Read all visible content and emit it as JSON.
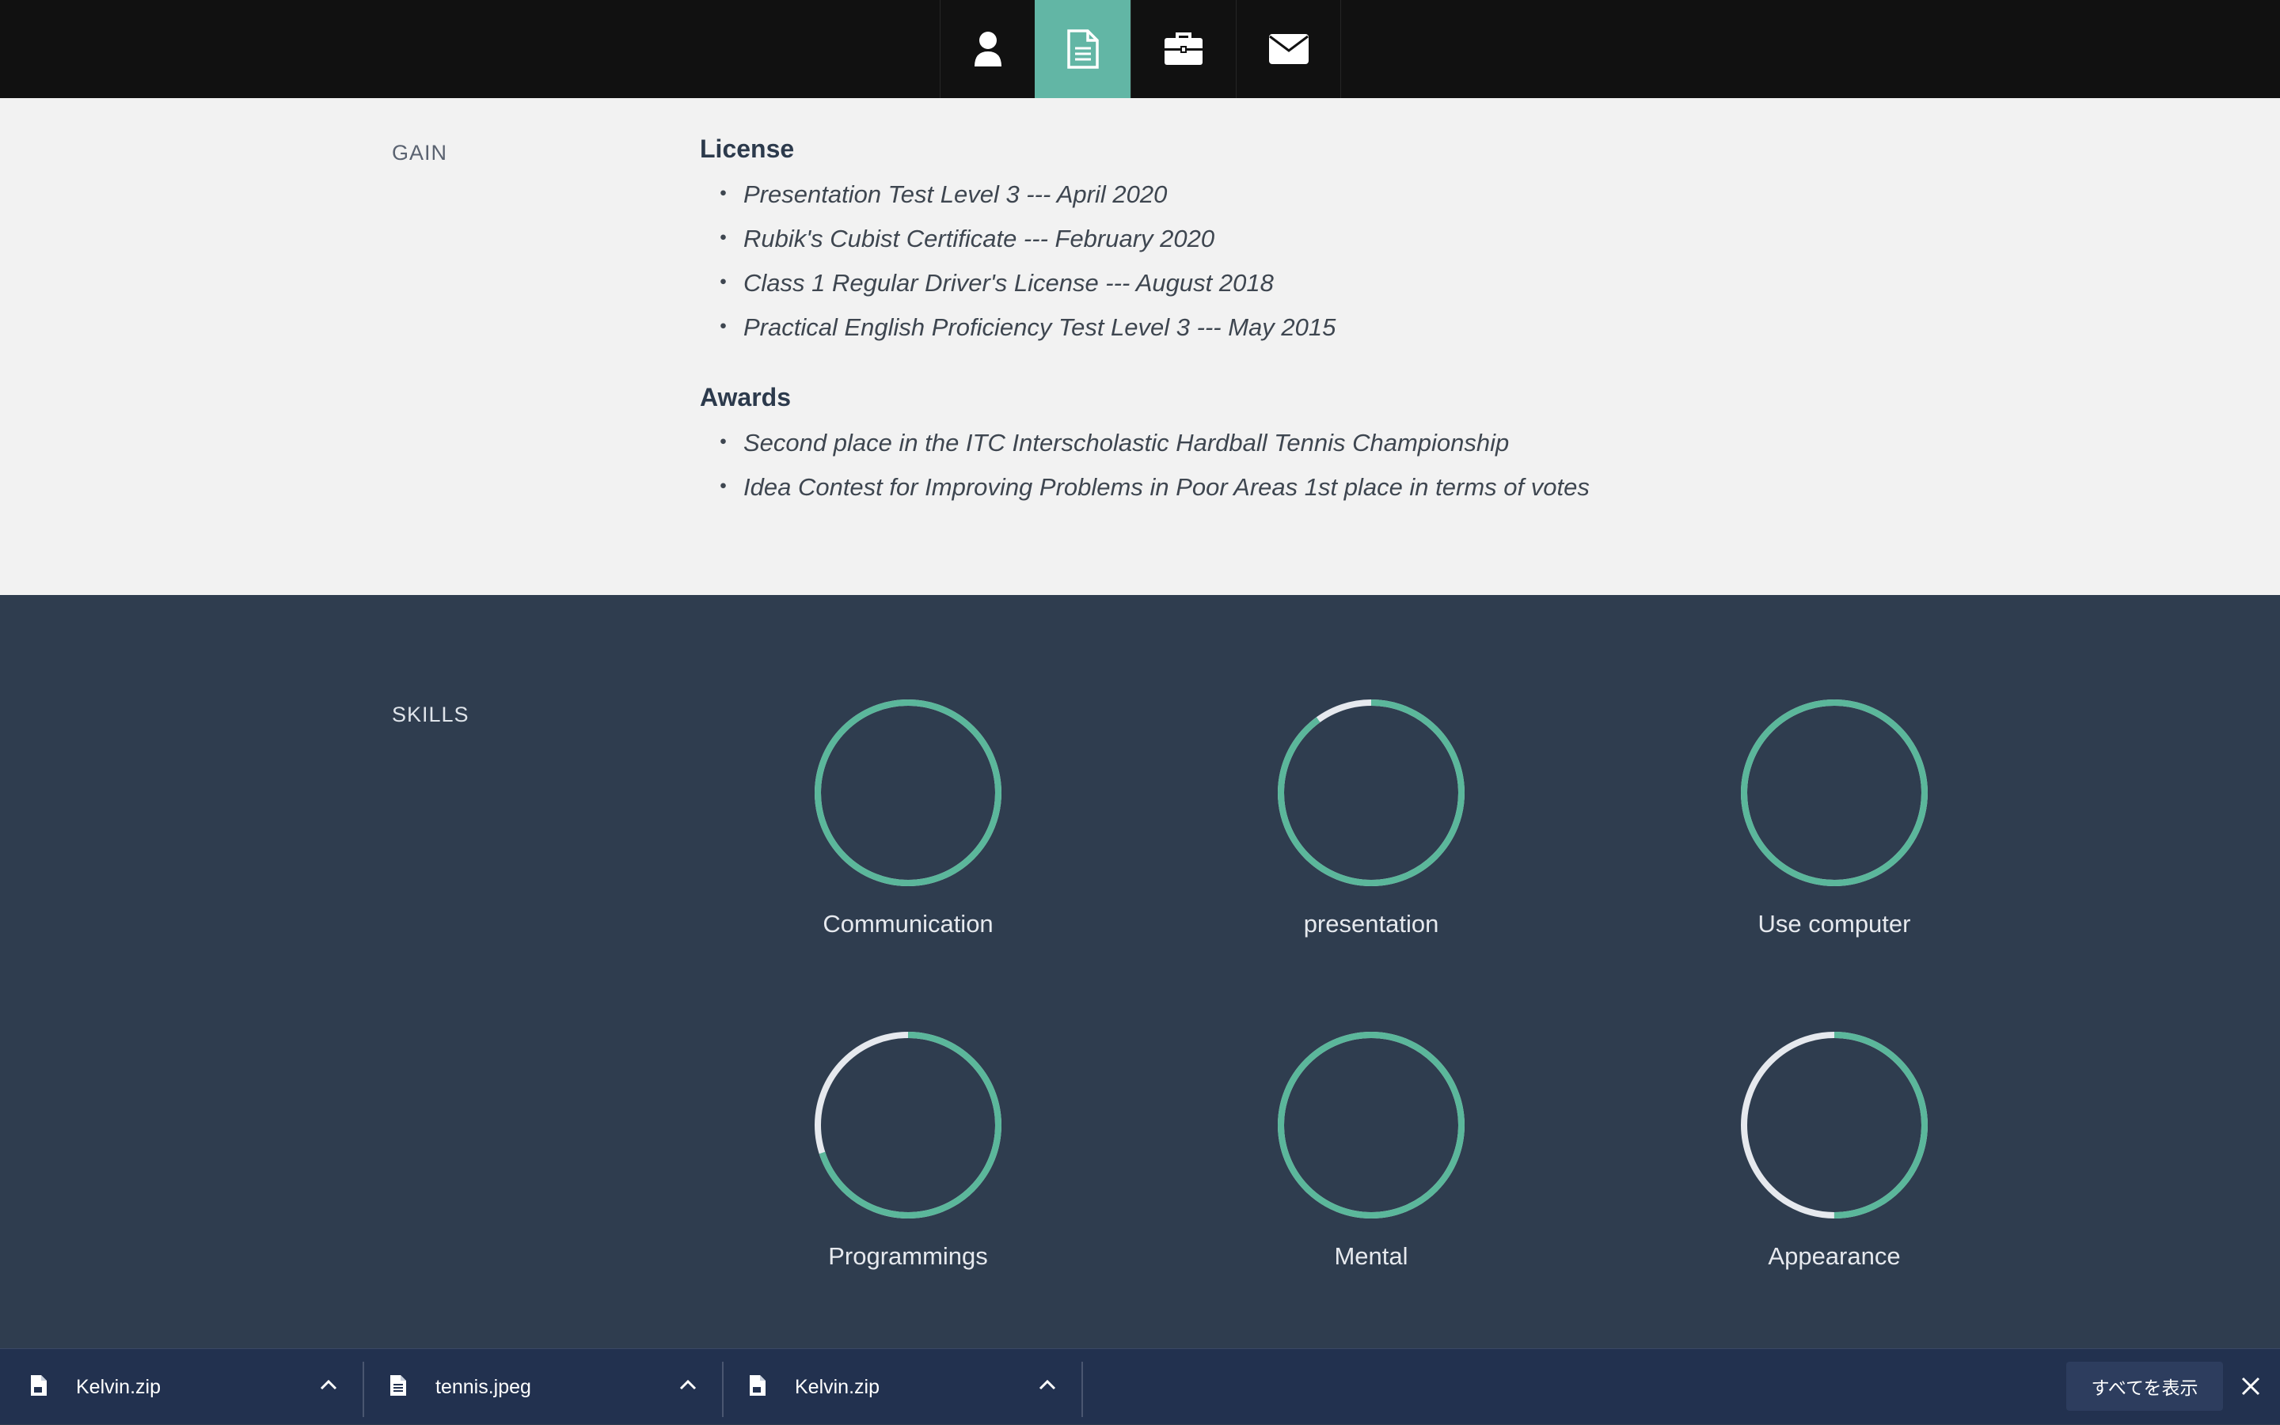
{
  "nav": {
    "items": [
      {
        "icon": "user-icon",
        "active": false
      },
      {
        "icon": "document-icon",
        "active": true
      },
      {
        "icon": "briefcase-icon",
        "active": false
      },
      {
        "icon": "envelope-icon",
        "active": false
      }
    ],
    "accent": "#62b6a5"
  },
  "gain": {
    "label": "GAIN",
    "license_title": "License",
    "licenses": [
      "Presentation Test Level 3 --- April 2020",
      "Rubik's Cubist Certificate --- February 2020",
      "Class 1 Regular Driver's License --- August 2018",
      "Practical English Proficiency Test Level 3 --- May 2015"
    ],
    "awards_title": "Awards",
    "awards": [
      "Second place in the ITC Interscholastic Hardball Tennis Championship",
      "Idea Contest for Improving Problems in Poor Areas 1st place in terms of votes"
    ],
    "bullet": "・"
  },
  "skills": {
    "label": "SKILLS",
    "ring_color": "#5bb79b",
    "track_color": "#e6e9ee",
    "items": [
      {
        "name": "Communication",
        "level": 1.0
      },
      {
        "name": "presentation",
        "level": 0.9
      },
      {
        "name": "Use computer",
        "level": 1.0
      },
      {
        "name": "Programmings",
        "level": 0.7
      },
      {
        "name": "Mental",
        "level": 1.0
      },
      {
        "name": "Appearance",
        "level": 0.5
      }
    ]
  },
  "downloads": {
    "files": [
      {
        "name": "Kelvin.zip",
        "icon": "zip-file-icon"
      },
      {
        "name": "tennis.jpeg",
        "icon": "image-file-icon"
      },
      {
        "name": "Kelvin.zip",
        "icon": "zip-file-icon"
      }
    ],
    "show_all": "すべてを表示"
  }
}
